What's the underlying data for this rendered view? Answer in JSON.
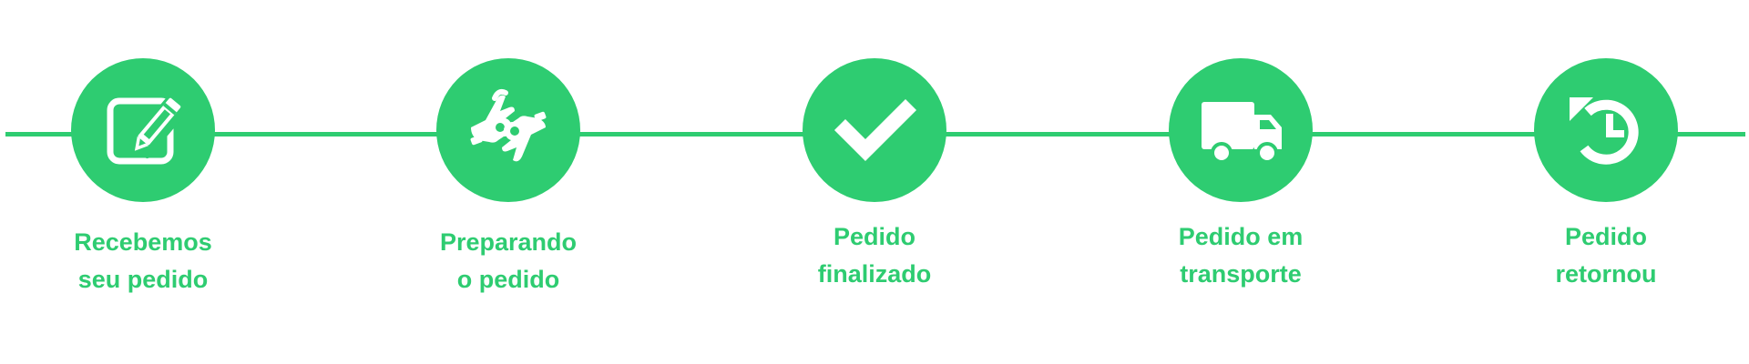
{
  "colors": {
    "accent": "#2ECC71",
    "icon": "#ffffff",
    "background": "#ffffff"
  },
  "steps": [
    {
      "icon": "edit-icon",
      "line1": "Recebemos",
      "line2": "seu pedido"
    },
    {
      "icon": "sign-language-icon",
      "line1": "Preparando",
      "line2": "o pedido"
    },
    {
      "icon": "checkmark-icon",
      "line1": "Pedido",
      "line2": "finalizado"
    },
    {
      "icon": "truck-icon",
      "line1": "Pedido em",
      "line2": "transporte"
    },
    {
      "icon": "history-icon",
      "line1": "Pedido",
      "line2": "retornou"
    }
  ]
}
